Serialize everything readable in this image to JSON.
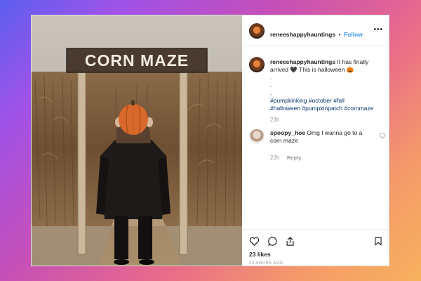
{
  "post": {
    "username": "reneeshappyhauntings",
    "dot": "•",
    "follow_label": "Follow",
    "more_label": "•••",
    "caption": {
      "username": "reneeshappyhauntings",
      "text_line1": " It has finally",
      "text_line2": "arrived 🖤  This is halloween 🎃",
      "dots": [
        ".",
        ".",
        "."
      ],
      "hashtags_line1": "#pumpkinking #october #fall",
      "hashtags_line2": "#halloween #pumpkinpatch #cornmaze",
      "time": "23h"
    },
    "comment": {
      "username": "spoopy_hoe",
      "text_line1": " Omg I wanna go to a",
      "text_line2": "corn maze",
      "time": "22h",
      "reply_label": "Reply"
    },
    "likes": "23 likes",
    "timestamp": "23 HOURS AGO"
  },
  "photo": {
    "sign_text": "CORN MAZE"
  },
  "icons": {
    "heart": "heart-icon",
    "comment": "comment-icon",
    "share": "share-icon",
    "save": "bookmark-icon",
    "more": "more-options-icon",
    "comment_like": "small-heart-icon"
  },
  "colors": {
    "follow": "#3897f0",
    "hashtag": "#003569",
    "pumpkin": "#d9692a"
  }
}
